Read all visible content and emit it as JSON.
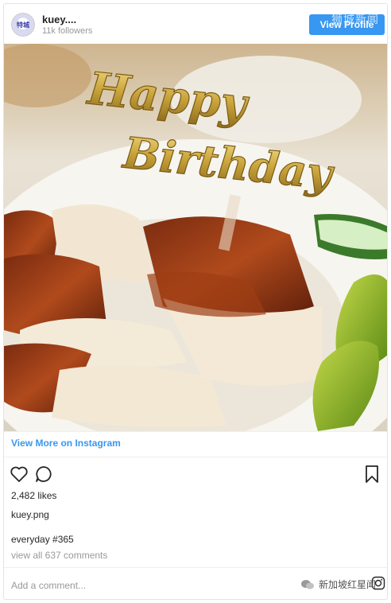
{
  "header": {
    "avatar_text": "特城",
    "username": "kuey....",
    "followers": "11k followers",
    "view_profile_label": "View Profile",
    "watermark": "狮城新闻"
  },
  "photo": {
    "cake_topper_line1": "Happy",
    "cake_topper_line2": "Birthday",
    "alt_icon": "chicken-rice-photo"
  },
  "link": {
    "view_more": "View More on Instagram"
  },
  "actions": {
    "like_icon": "heart-icon",
    "comment_icon": "comment-icon",
    "save_icon": "bookmark-icon"
  },
  "post": {
    "likes": "2,482 likes",
    "caption_user": "kuey.png",
    "caption": "everyday #365",
    "comments_link": "view all 637 comments"
  },
  "comment_box": {
    "placeholder": "Add a comment..."
  },
  "watermark_bottom": {
    "text": "新加坡红星闻"
  },
  "colors": {
    "accent": "#3897f0",
    "muted": "#999999",
    "text": "#262626"
  }
}
